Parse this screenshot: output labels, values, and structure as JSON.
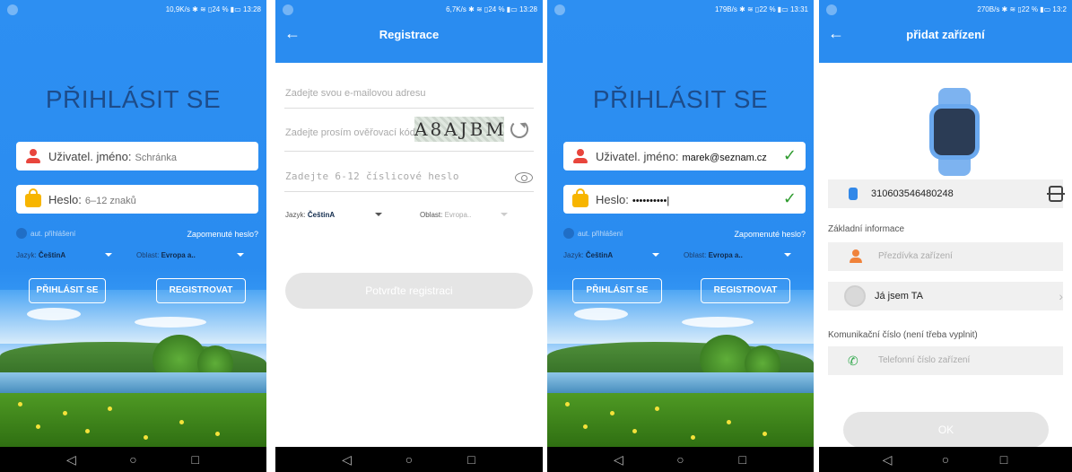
{
  "screens": {
    "login": {
      "title": "PŘIHLÁSIT SE",
      "username_label": "Uživatel. jméno:",
      "username_placeholder": "Schránka",
      "password_label": "Heslo:",
      "password_placeholder": "6–12 znaků",
      "auto_login": "aut. přihlášení",
      "forgot": "Zapomenuté heslo?",
      "language_label": "Jazyk:",
      "language_value": "ČeštinA",
      "region_label": "Oblast:",
      "region_value": "Evropa a..",
      "login_button": "PŘIHLÁSIT SE",
      "register_button": "REGISTROVAT",
      "status_text": "10,9K/s ✱ ≋ ▯24 % ▮▭ 13:28"
    },
    "register": {
      "title": "Registrace",
      "email_placeholder": "Zadejte svou e-mailovou adresu",
      "code_placeholder": "Zadejte prosím ověřovací kód",
      "captcha": "A8AJBM",
      "password_placeholder": "Zadejte 6-12 číslicové heslo",
      "language_label": "Jazyk:",
      "language_value": "ČeštinA",
      "region_label": "Oblast:",
      "region_value": "Evropa..",
      "confirm_button": "Potvrďte registraci",
      "status_text": "6,7K/s ✱ ≋ ▯24 % ▮▭ 13:28"
    },
    "login_filled": {
      "title": "PŘIHLÁSIT SE",
      "username_label": "Uživatel. jméno:",
      "username_value": "marek@seznam.cz",
      "password_label": "Heslo:",
      "password_value": "••••••••••|",
      "auto_login": "aut. přihlášení",
      "forgot": "Zapomenuté heslo?",
      "language_label": "Jazyk:",
      "language_value": "ČeštinA",
      "region_label": "Oblast:",
      "region_value": "Evropa a..",
      "login_button": "PŘIHLÁSIT SE",
      "register_button": "REGISTROVAT",
      "status_text": "179B/s ✱ ≋ ▯22 % ▮▭ 13:31"
    },
    "add_device": {
      "title": "přidat zařízení",
      "device_id": "310603546480248",
      "basic_info": "Základní informace",
      "nickname_placeholder": "Přezdívka zařízení",
      "relation": "Já jsem TA",
      "comm_label": "Komunikační číslo (není třeba vyplnit)",
      "phone_placeholder": "Telefonní číslo zařízení",
      "ok_button": "OK",
      "status_text": "270B/s ✱ ≋ ▯22 % ▮▭ 13:2"
    }
  },
  "nav": {
    "back": "◁",
    "home": "○",
    "recent": "□"
  },
  "icons": {
    "back_arrow": "←",
    "checkmark": "✓",
    "chevron": "›",
    "phone": "✆"
  },
  "colors": {
    "primary": "#2a8cf0",
    "title_dark": "#1d4c8a",
    "check_green": "#2e9b2e"
  }
}
